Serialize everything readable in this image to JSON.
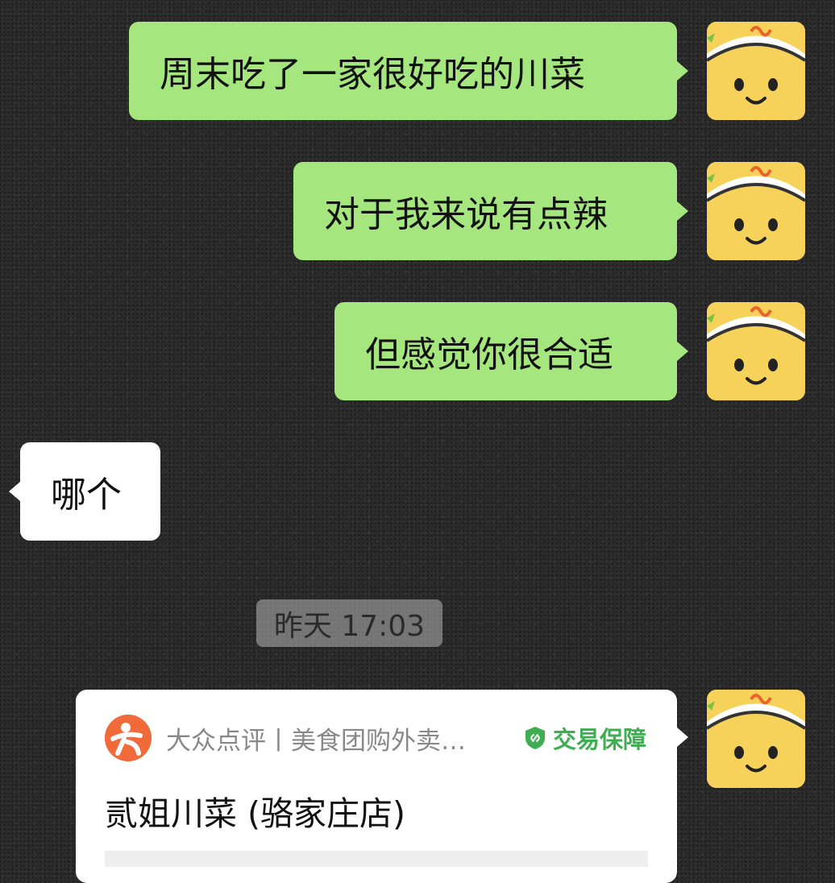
{
  "messages": [
    {
      "direction": "out",
      "text": "周末吃了一家很好吃的川菜"
    },
    {
      "direction": "out",
      "text": "对于我来说有点辣"
    },
    {
      "direction": "out",
      "text": "但感觉你很合适"
    },
    {
      "direction": "in",
      "text": "哪个"
    }
  ],
  "timestamp": "昨天 17:03",
  "link_card": {
    "source": "大众点评丨美食团购外卖…",
    "badge": "交易保障",
    "title": "贰姐川菜 (骆家庄店)"
  },
  "avatar": {
    "icon": "smiley-face-avatar",
    "color": "#f6d25a"
  },
  "colors": {
    "outgoing_bubble": "#a5e77e",
    "incoming_bubble": "#ffffff",
    "badge_green": "#3fae52",
    "logo_orange": "#f06a3a"
  }
}
